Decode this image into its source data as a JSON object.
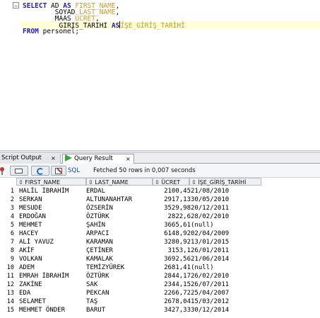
{
  "editor": {
    "fold_symbol": "−",
    "lines": [
      {
        "prefix": "",
        "kw": "SELECT",
        "text": " AD ",
        "kw2": "AS",
        "alias": " FIRST_NAME",
        "suffix": ","
      },
      {
        "prefix": "        ",
        "kw": "",
        "text": "SOYAD ",
        "kw2": "",
        "alias": "LAST_NAME",
        "suffix": ","
      },
      {
        "prefix": "        ",
        "kw": "",
        "text": "MAAS ",
        "kw2": "",
        "alias": "ÜCRET",
        "suffix": ","
      },
      {
        "prefix": "        ",
        "kw": "",
        "text": "GIRIS_TARIHI ",
        "kw2": "AS",
        "alias": "İŞE_GİRİŞ_TARİHİ",
        "suffix": ""
      },
      {
        "prefix": "",
        "kw": "FROM",
        "text": " personel;",
        "kw2": "",
        "alias": "",
        "suffix": ""
      }
    ]
  },
  "tabs": {
    "script_output": "Script Output",
    "query_result": "Query Result",
    "close": "×"
  },
  "toolbar": {
    "sql_label": "SQL",
    "status": "Fetched 50 rows in 0,007 seconds"
  },
  "grid": {
    "columns": [
      "FIRST_NAME",
      "LAST_NAME",
      "ÜCRET",
      "İŞE_GİRİŞ_TARİHİ"
    ],
    "rows": [
      [
        "1",
        "HALİL İBRAHİM",
        "ERDAL",
        "2100,45",
        "21/08/2010"
      ],
      [
        "2",
        "SERKAN",
        "ALTUNANAHTAR",
        "2917,13",
        "30/05/2010"
      ],
      [
        "3",
        "MESUDE",
        "ÖZSERİN",
        "3529,98",
        "20/12/2011"
      ],
      [
        "4",
        "ERDOĞAN",
        "ÖZTÜRK",
        "2822,6",
        "28/02/2010"
      ],
      [
        "5",
        "MEHMET",
        "ŞAHİN",
        "3665,61",
        "(null)"
      ],
      [
        "6",
        "HACEY",
        "ARPACI",
        "6148,92",
        "02/04/2009"
      ],
      [
        "7",
        "ALİ YAVUZ",
        "KARAMAN",
        "3280,92",
        "13/01/2015"
      ],
      [
        "8",
        "AKİF",
        "ÇETİNER",
        "3153,1",
        "26/01/2011"
      ],
      [
        "9",
        "VOLKAN",
        "KAMALAK",
        "3692,56",
        "21/06/2014"
      ],
      [
        "10",
        "ADEM",
        "TEMİZYÜREK",
        "2681,41",
        "(null)"
      ],
      [
        "11",
        "EMRAH İBRAHİM",
        "ÖZTÜRK",
        "2844,17",
        "26/02/2010"
      ],
      [
        "12",
        "ZAKİNE",
        "SAK",
        "2344,15",
        "26/07/2011"
      ],
      [
        "13",
        "EDA",
        "PEKCAN",
        "2266,72",
        "25/04/2007"
      ],
      [
        "14",
        "SELAMET",
        "TAŞ",
        "2678,04",
        "15/03/2012"
      ],
      [
        "15",
        "MEHMET ÖNDER",
        "BARUT",
        "3427,33",
        "30/12/2014"
      ]
    ]
  }
}
